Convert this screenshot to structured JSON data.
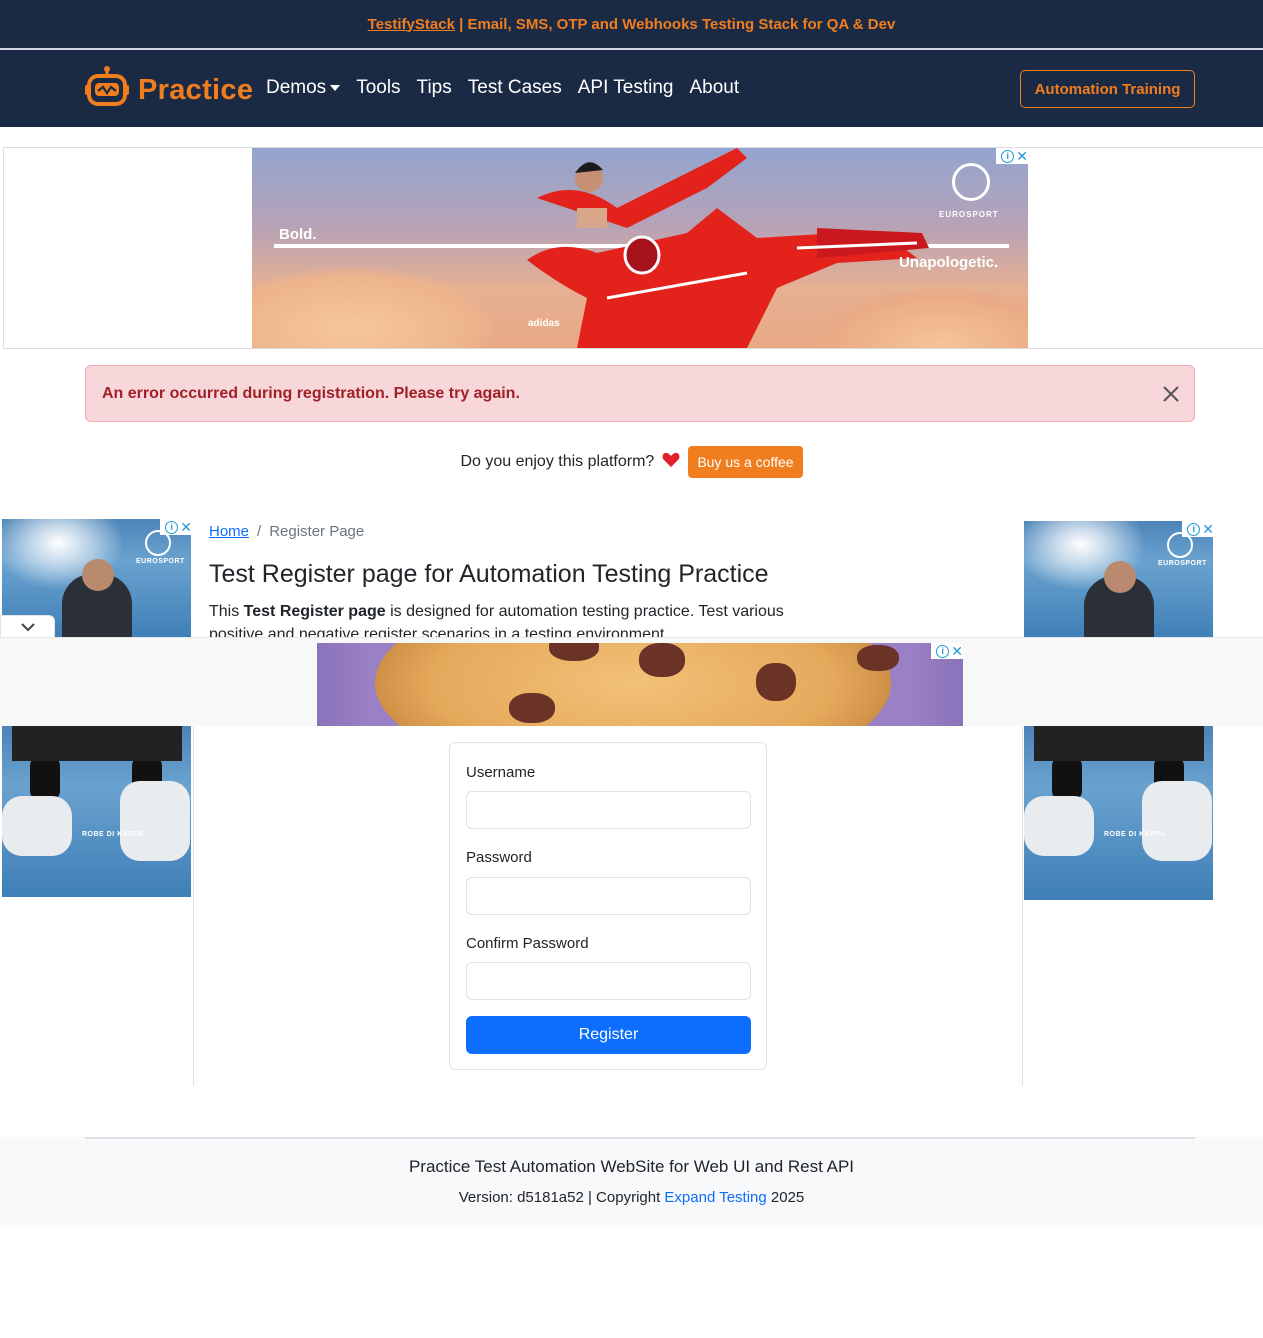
{
  "announcement": {
    "link_text": "TestifyStack",
    "text": " | Email, SMS, OTP and Webhooks Testing Stack for QA & Dev"
  },
  "navbar": {
    "brand": "Practice",
    "brand_icon": "robot-icon",
    "links": [
      "Demos",
      "Tools",
      "Tips",
      "Test Cases",
      "API Testing",
      "About"
    ],
    "cta_label": "Automation Training"
  },
  "ads": {
    "top_banner": {
      "left_tagline": "Bold.",
      "right_tagline": "Unapologetic.",
      "sponsor_brand": "EUROSPORT",
      "product_brand": "adidas"
    },
    "side_sponsor": "EUROSPORT",
    "side_product": "ROBE DI KAPPA"
  },
  "alert": {
    "message": "An error occurred during registration. Please try again.",
    "type": "danger",
    "color": "#a02128"
  },
  "support": {
    "question": "Do you enjoy this platform?",
    "button_label": "Buy us a coffee"
  },
  "breadcrumb": {
    "home": "Home",
    "separator": "/",
    "current": "Register Page"
  },
  "page": {
    "title": "Test Register page for Automation Testing Practice",
    "desc_prefix": "This ",
    "desc_bold": "Test Register page",
    "desc_suffix": " is designed for automation testing practice. Test various positive and negative register scenarios in a testing environment."
  },
  "form": {
    "username_label": "Username",
    "username_value": "",
    "password_label": "Password",
    "password_value": "",
    "confirm_label": "Confirm Password",
    "confirm_value": "",
    "submit_label": "Register"
  },
  "footer": {
    "title": "Practice Test Automation WebSite for Web UI and Rest API",
    "version_prefix": "Version: d5181a52 | Copyright ",
    "company": "Expand Testing",
    "year": " 2025"
  },
  "colors": {
    "nav_bg": "#1a2a44",
    "accent": "#f07d1e",
    "primary": "#0d6efd",
    "alert_bg": "#f8d7da"
  }
}
